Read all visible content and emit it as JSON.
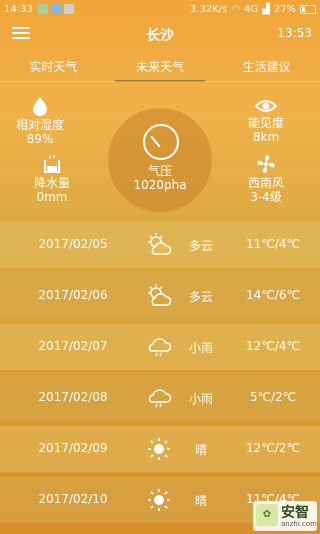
{
  "status_bar": {
    "time": "14:33",
    "network_speed": "3.32K/s",
    "network_type": "4G",
    "battery": "27%"
  },
  "header": {
    "city": "长沙",
    "clock": "13:53"
  },
  "tabs": [
    {
      "label": "实时天气"
    },
    {
      "label": "未来天气"
    },
    {
      "label": "生活建议"
    }
  ],
  "current": {
    "humidity": {
      "label": "相对湿度",
      "value": "89%",
      "icon": "water-drop-icon"
    },
    "visibility": {
      "label": "能见度",
      "value": "8km",
      "icon": "eye-icon"
    },
    "pressure": {
      "label": "气压",
      "value": "1020pha",
      "icon": "gauge-icon"
    },
    "precipitation": {
      "label": "降水量",
      "value": "0mm",
      "icon": "rain-gauge-icon"
    },
    "wind": {
      "label": "西南风",
      "value": "3-4级",
      "icon": "fan-icon"
    }
  },
  "forecast": [
    {
      "date": "2017/02/05",
      "condition": "多云",
      "temp": "11℃/4℃",
      "icon": "partly-cloudy-icon"
    },
    {
      "date": "2017/02/06",
      "condition": "多云",
      "temp": "14℃/6℃",
      "icon": "partly-cloudy-icon"
    },
    {
      "date": "2017/02/07",
      "condition": "小雨",
      "temp": "12℃/4℃",
      "icon": "rain-cloud-icon"
    },
    {
      "date": "2017/02/08",
      "condition": "小雨",
      "temp": "5℃/2℃",
      "icon": "rain-cloud-icon"
    },
    {
      "date": "2017/02/09",
      "condition": "晴",
      "temp": "12℃/2℃",
      "icon": "sun-icon"
    },
    {
      "date": "2017/02/10",
      "condition": "晴",
      "temp": "11℃/4℃",
      "icon": "sun-icon"
    }
  ],
  "watermark": {
    "text": "安智",
    "sub": "anzhi.com"
  },
  "colors": {
    "bg_top": "#f1a53a",
    "bg_bottom": "#d8902a",
    "tab_underline": "#9a7b3f"
  }
}
